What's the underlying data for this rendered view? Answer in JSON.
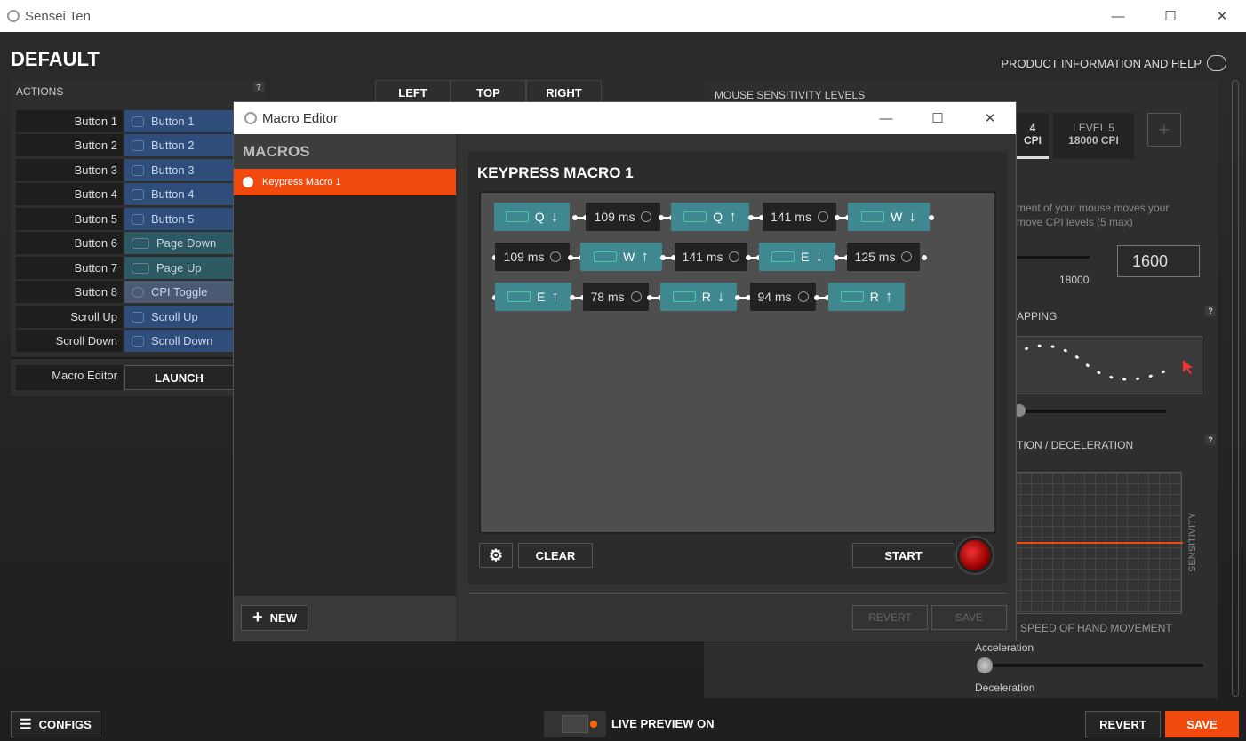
{
  "app": {
    "title": "Sensei Ten"
  },
  "header": {
    "config_name": "DEFAULT",
    "help_link": "PRODUCT INFORMATION AND HELP"
  },
  "actions": {
    "title": "ACTIONS",
    "help": "?",
    "rows": [
      {
        "label": "Button 1",
        "value": "Button 1"
      },
      {
        "label": "Button 2",
        "value": "Button 2"
      },
      {
        "label": "Button 3",
        "value": "Button 3"
      },
      {
        "label": "Button 4",
        "value": "Button 4"
      },
      {
        "label": "Button 5",
        "value": "Button 5"
      },
      {
        "label": "Button 6",
        "value": "Page Down"
      },
      {
        "label": "Button 7",
        "value": "Page Up"
      },
      {
        "label": "Button 8",
        "value": "CPI Toggle"
      },
      {
        "label": "Scroll Up",
        "value": "Scroll Up"
      },
      {
        "label": "Scroll Down",
        "value": "Scroll Down"
      }
    ],
    "macro_label": "Macro Editor",
    "launch": "LAUNCH"
  },
  "view_tabs": [
    "LEFT",
    "TOP",
    "RIGHT"
  ],
  "sensitivity": {
    "title": "MOUSE SENSITIVITY LEVELS",
    "level4_top": "4",
    "level4_bottom": "CPI",
    "level5_top": "LEVEL 5",
    "level5_bottom": "18000 CPI",
    "add": "+",
    "desc1": "ment of your mouse moves your",
    "desc2": "move CPI levels (5 max)",
    "slider_max": "18000",
    "cpi_value": "1600",
    "mapping_title": "APPING",
    "accel_title": "TION / DECELERATION",
    "y_axis": "SENSITIVITY",
    "x_axis": "SPEED OF HAND MOVEMENT",
    "accel_label": "Acceleration",
    "decel_label": "Deceleration",
    "help": "?"
  },
  "bottom": {
    "configs": "CONFIGS",
    "live_preview": "LIVE PREVIEW ON",
    "revert": "REVERT",
    "save": "SAVE"
  },
  "macro_editor": {
    "title": "Macro Editor",
    "sidebar_title": "MACROS",
    "macros": [
      "Keypress Macro 1"
    ],
    "new": "NEW",
    "macro_name": "KEYPRESS MACRO 1",
    "steps": [
      {
        "type": "key",
        "label": "Q",
        "dir": "down"
      },
      {
        "type": "delay",
        "label": "109 ms"
      },
      {
        "type": "key",
        "label": "Q",
        "dir": "up"
      },
      {
        "type": "delay",
        "label": "141 ms"
      },
      {
        "type": "key",
        "label": "W",
        "dir": "down"
      },
      {
        "type": "delay",
        "label": "109 ms"
      },
      {
        "type": "key",
        "label": "W",
        "dir": "up"
      },
      {
        "type": "delay",
        "label": "141 ms"
      },
      {
        "type": "key",
        "label": "E",
        "dir": "down"
      },
      {
        "type": "delay",
        "label": "125 ms"
      },
      {
        "type": "key",
        "label": "E",
        "dir": "up"
      },
      {
        "type": "delay",
        "label": "78 ms"
      },
      {
        "type": "key",
        "label": "R",
        "dir": "down"
      },
      {
        "type": "delay",
        "label": "94 ms"
      },
      {
        "type": "key",
        "label": "R",
        "dir": "up"
      }
    ],
    "clear": "CLEAR",
    "start": "START",
    "revert": "REVERT",
    "save": "SAVE"
  }
}
